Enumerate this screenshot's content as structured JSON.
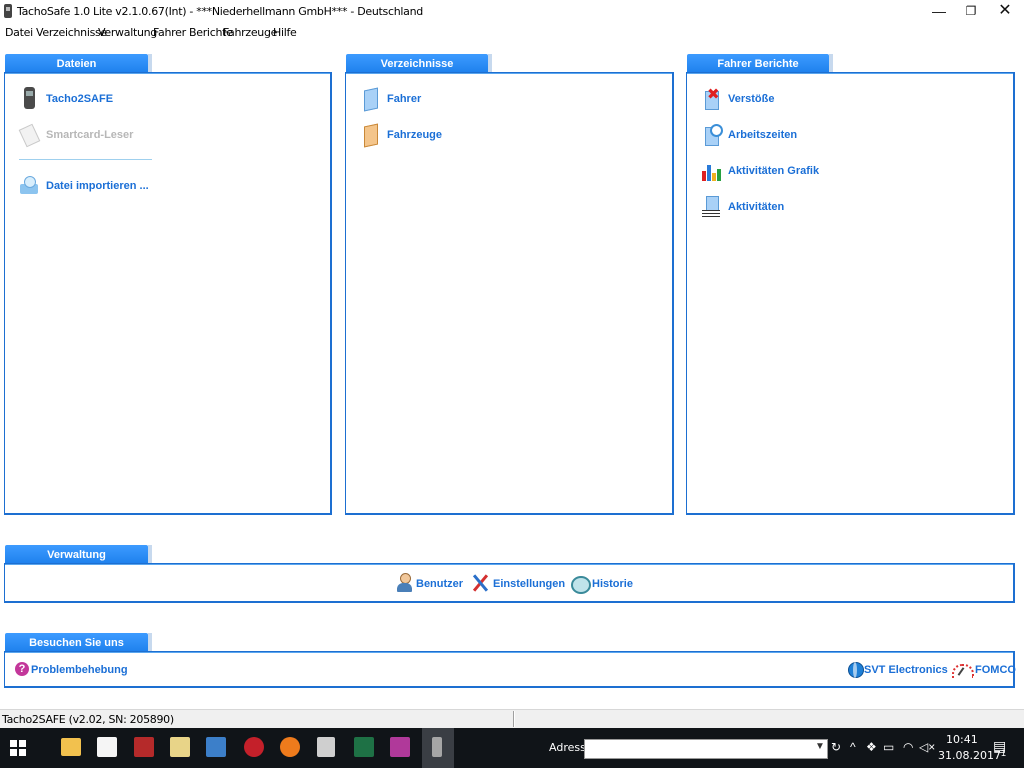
{
  "window": {
    "title": "TachoSafe 1.0 Lite v2.1.0.67(Int) - ***Niederhellmann GmbH*** - Deutschland",
    "minimize_glyph": "—",
    "maximize_glyph": "❐",
    "close_glyph": "✕"
  },
  "menu": [
    "Datei",
    "Verzeichnisse",
    "Verwaltung",
    "Fahrer Berichte",
    "Fahrzeuge",
    "Hilfe"
  ],
  "dateien": {
    "tab": "Dateien",
    "items": [
      {
        "label": "Tacho2SAFE",
        "icon": "device-icon"
      },
      {
        "label": "Smartcard-Leser",
        "icon": "smartcard-icon",
        "disabled": true
      },
      {
        "label": "Datei importieren ...",
        "icon": "import-disk-icon"
      }
    ]
  },
  "verzeichnisse": {
    "tab": "Verzeichnisse",
    "items": [
      {
        "label": "Fahrer",
        "icon": "driver-book-icon"
      },
      {
        "label": "Fahrzeuge",
        "icon": "vehicle-book-icon"
      }
    ]
  },
  "fahrer_berichte": {
    "tab": "Fahrer Berichte",
    "items": [
      {
        "label": "Verstöße",
        "icon": "violation-icon"
      },
      {
        "label": "Arbeitszeiten",
        "icon": "clock-icon"
      },
      {
        "label": "Aktivitäten Grafik",
        "icon": "chart-icon"
      },
      {
        "label": "Aktivitäten",
        "icon": "activity-list-icon"
      }
    ]
  },
  "verwaltung": {
    "tab": "Verwaltung",
    "items": [
      {
        "label": "Benutzer",
        "icon": "user-icon"
      },
      {
        "label": "Einstellungen",
        "icon": "tools-icon"
      },
      {
        "label": "Historie",
        "icon": "history-icon"
      }
    ]
  },
  "besuchen": {
    "tab": "Besuchen Sie uns",
    "problem": "Problembehebung",
    "svt": "SVT Electronics",
    "fomco": "FOMCO"
  },
  "status": {
    "text": "Tacho2SAFE (v2.02, SN: 205890)"
  },
  "taskbar": {
    "address_label": "Adresse",
    "address_value": "",
    "time": "10:41",
    "date": "31.08.2017",
    "notification_count": "1"
  },
  "colors": {
    "accent": "#1c7fec",
    "link": "#1b6fd6",
    "disabled": "#b7b7b7"
  }
}
